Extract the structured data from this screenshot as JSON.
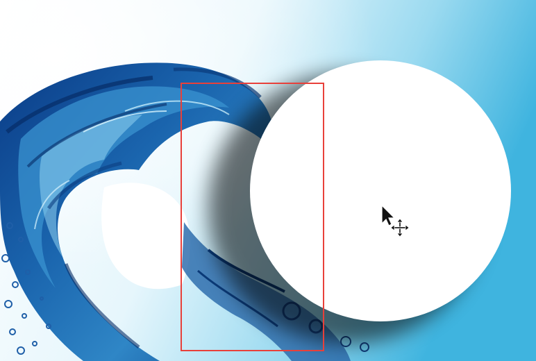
{
  "canvas": {
    "description_colors": {
      "background_light": "#f4fbfe",
      "background_cyan": "#5cc3e4",
      "water_dark": "#0a3f8a",
      "water_mid": "#1f73b8",
      "water_light": "#7ccbec",
      "circle_fill": "#ffffff",
      "selection_border": "#e8403a"
    }
  },
  "tool": {
    "cursor_icon": "move-tool-cursor"
  }
}
